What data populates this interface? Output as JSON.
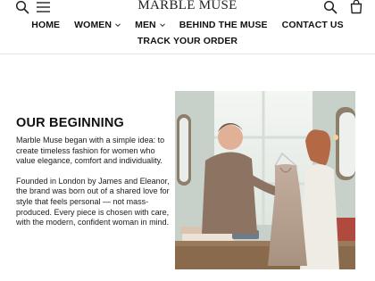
{
  "header": {
    "brand": "MARBLE MUSE",
    "nav_primary": [
      {
        "label": "HOME",
        "dropdown": false
      },
      {
        "label": "WOMEN",
        "dropdown": true
      },
      {
        "label": "MEN",
        "dropdown": true
      },
      {
        "label": "BEHIND THE MUSE",
        "dropdown": false
      },
      {
        "label": "CONTACT US",
        "dropdown": false
      }
    ],
    "nav_secondary": [
      {
        "label": "TRACK YOUR ORDER"
      }
    ],
    "icons": [
      "search-icon",
      "menu-icon",
      "search-icon",
      "bag-icon"
    ]
  },
  "main": {
    "heading": "OUR BEGINNING",
    "paragraph1": "Marble Muse began with a simple idea: to create timeless fashion for women who value elegance, comfort and individuality.",
    "paragraph2": "Founded in London by James and Eleanor, the brand was born out of a shared love for style that feels personal — not mass-produced. Every piece is chosen with care, with the modern, confident woman in mind."
  },
  "colors": {
    "text": "#111111",
    "divider": "#e6e6e6",
    "dress": "#b8a394",
    "wall": "#cdd6cf"
  }
}
